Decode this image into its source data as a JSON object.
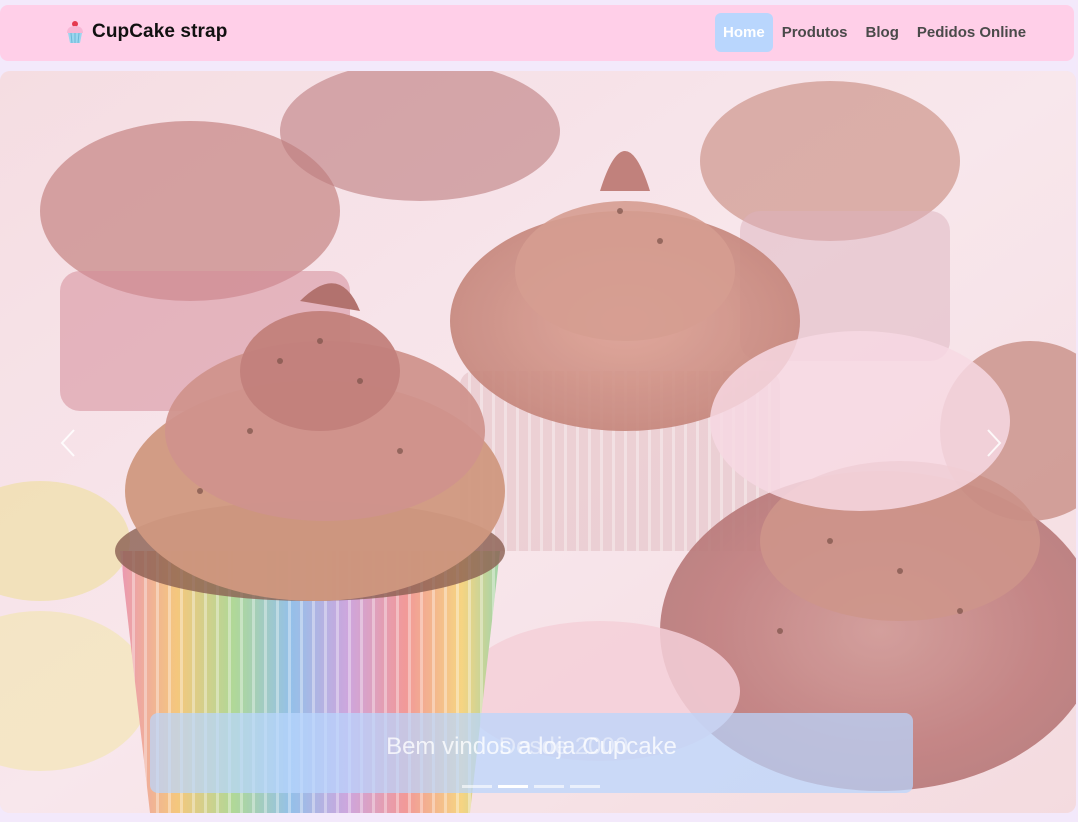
{
  "navbar": {
    "brand": "CupCake strap",
    "brand_icon": "cupcake-icon",
    "links": [
      {
        "label": "Home",
        "active": true
      },
      {
        "label": "Produtos",
        "active": false
      },
      {
        "label": "Blog",
        "active": false
      },
      {
        "label": "Pedidos Online",
        "active": false
      }
    ]
  },
  "carousel": {
    "caption_primary": "Bem vindos a loja Cupcake",
    "caption_ghost": "Desde 2000",
    "indicators": 4,
    "active_indicator": 2,
    "prev_icon": "chevron-left-icon",
    "next_icon": "chevron-right-icon"
  },
  "colors": {
    "navbar_bg": "#ffcfe8",
    "active_link_bg": "#b9d6fd",
    "page_bg": "#f3e9fb"
  }
}
